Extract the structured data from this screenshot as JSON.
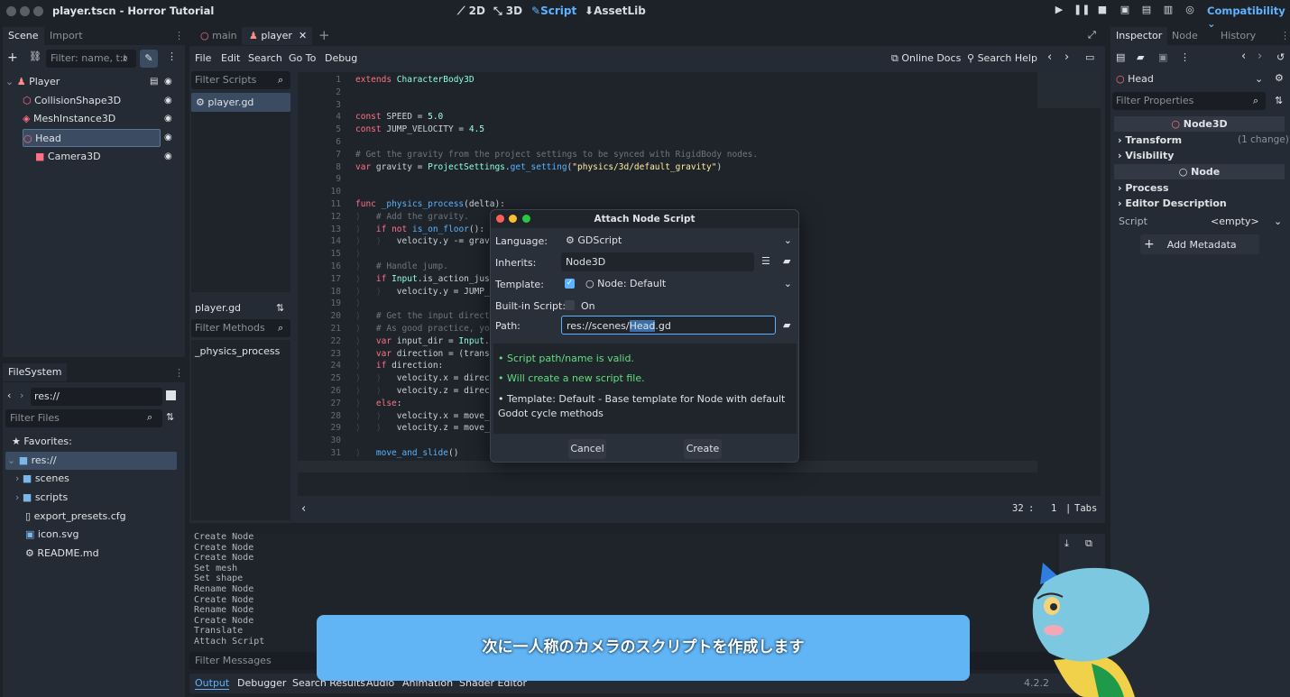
{
  "window": {
    "title": "player.tscn - Horror Tutorial",
    "workspaces": [
      "2D",
      "3D",
      "Script",
      "AssetLib"
    ],
    "active_workspace": "Script",
    "renderer": "Compatibility"
  },
  "scene_dock": {
    "tabs": [
      "Scene",
      "Import"
    ],
    "filter_placeholder": "Filter: name, t:t",
    "nodes": [
      {
        "label": "Player",
        "icon": "character-body-icon"
      },
      {
        "label": "CollisionShape3D",
        "icon": "collision-shape-icon"
      },
      {
        "label": "MeshInstance3D",
        "icon": "mesh-instance-icon"
      },
      {
        "label": "Head",
        "icon": "node3d-icon"
      },
      {
        "label": "Camera3D",
        "icon": "camera-icon"
      }
    ],
    "selected": "Head"
  },
  "filesystem_dock": {
    "tab": "FileSystem",
    "path": "res://",
    "filter_placeholder": "Filter Files",
    "favorites_label": "Favorites:",
    "items": [
      {
        "label": "res://",
        "icon": "folder-icon"
      },
      {
        "label": "scenes",
        "icon": "folder-icon"
      },
      {
        "label": "scripts",
        "icon": "folder-icon"
      },
      {
        "label": "export_presets.cfg",
        "icon": "file-icon"
      },
      {
        "label": "icon.svg",
        "icon": "image-icon"
      },
      {
        "label": "README.md",
        "icon": "file-icon"
      }
    ]
  },
  "editor_tabs": [
    "main",
    "player"
  ],
  "script_menu": [
    "File",
    "Edit",
    "Search",
    "Go To",
    "Debug"
  ],
  "script_toolbar": {
    "docs": "Online Docs",
    "help": "Search Help"
  },
  "script_list": {
    "filter_placeholder": "Filter Scripts",
    "scripts": [
      "player.gd"
    ],
    "current": "player.gd",
    "methods_placeholder": "Filter Methods",
    "methods": [
      "_physics_process"
    ]
  },
  "code_lines": [
    "extends CharacterBody3D",
    "",
    "",
    "const SPEED = 5.0",
    "const JUMP_VELOCITY = 4.5",
    "",
    "# Get the gravity from the project settings to be synced with RigidBody nodes.",
    "var gravity = ProjectSettings.get_setting(\"physics/3d/default_gravity\")",
    "",
    "",
    "func _physics_process(delta):",
    "# Add the gravity.",
    "if not is_on_floor():",
    "velocity.y -= gravit",
    "",
    "# Handle jump.",
    "if Input.is_action_just_",
    "velocity.y = JUMP_VEL",
    "",
    "# Get the input directio",
    "# As good practice, you s",
    "var input_dir = Input.get",
    "var direction = (transfor",
    "if direction:",
    "velocity.x = directi",
    "velocity.z = directi",
    "else:",
    "velocity.x = move_to",
    "velocity.z = move_to",
    "",
    "move_and_slide()",
    ""
  ],
  "status_bar": {
    "line": "32",
    "col": "1",
    "indent": "Tabs"
  },
  "dialog": {
    "title": "Attach Node Script",
    "language_label": "Language:",
    "language_value": "GDScript",
    "inherits_label": "Inherits:",
    "inherits_value": "Node3D",
    "template_label": "Template:",
    "template_value": "Node: Default",
    "builtin_label": "Built-in Script:",
    "builtin_value": "On",
    "path_label": "Path:",
    "path_prefix": "res://scenes/",
    "path_highlight": "Head",
    "path_suffix": ".gd",
    "messages": [
      "Script path/name is valid.",
      "Will create a new script file.",
      "Template: Default - Base template for Node with default Godot cycle methods"
    ],
    "cancel": "Cancel",
    "create": "Create"
  },
  "output_panel": {
    "log": [
      "Create Node",
      "Create Node",
      "Create Node",
      "Set mesh",
      "Set shape",
      "Rename Node",
      "Create Node",
      "Rename Node",
      "Create Node",
      "Translate",
      "Attach Script"
    ],
    "filter_placeholder": "Filter Messages",
    "tabs": [
      "Output",
      "Debugger",
      "Search Results",
      "Audio",
      "Animation",
      "Shader Editor"
    ],
    "version": "4.2.2"
  },
  "inspector": {
    "tabs": [
      "Inspector",
      "Node",
      "History"
    ],
    "object": "Head",
    "filter_placeholder": "Filter Properties",
    "sections": [
      {
        "header": "Node3D",
        "rows": [
          {
            "label": "Transform",
            "note": "(1 change)"
          },
          {
            "label": "Visibility",
            "note": ""
          }
        ]
      },
      {
        "header": "Node",
        "rows": [
          {
            "label": "Process",
            "note": ""
          },
          {
            "label": "Editor Description",
            "note": ""
          }
        ]
      }
    ],
    "script_label": "Script",
    "script_value": "<empty>",
    "add_metadata": "Add Metadata"
  },
  "subtitle": "次に一人称のカメラのスクリプトを作成します",
  "colors": {
    "accent": "#5fb2ff",
    "selection": "#3b4c62",
    "subtitle_bg": "#62b5f5"
  }
}
